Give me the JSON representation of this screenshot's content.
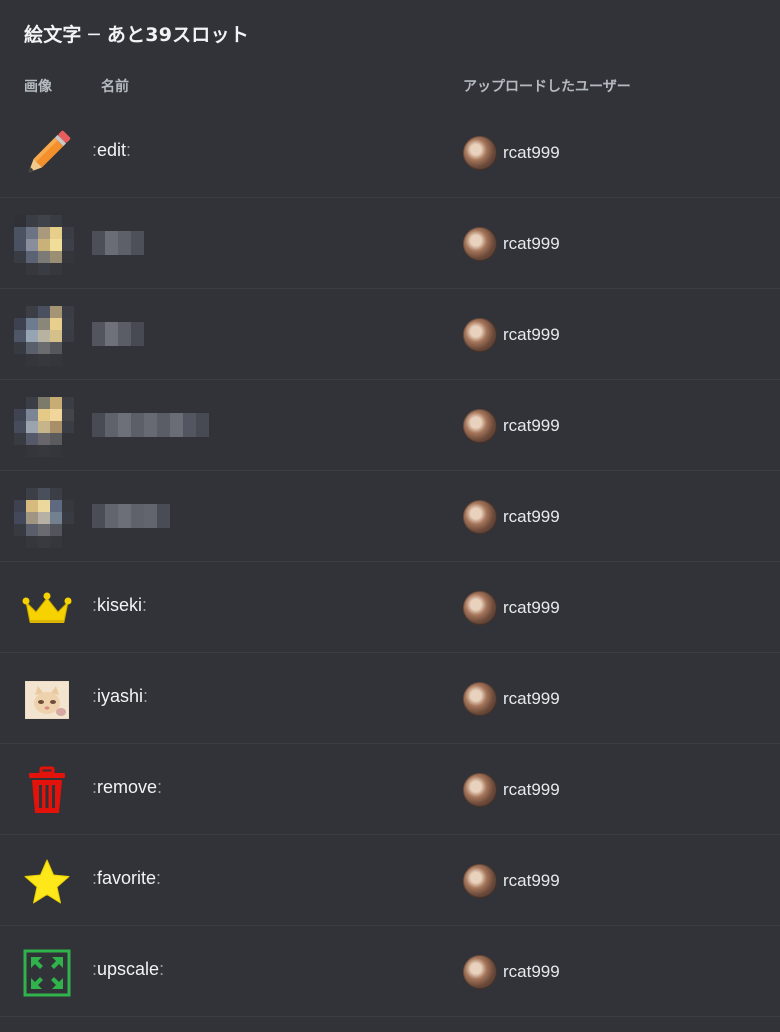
{
  "header": {
    "title": "絵文字 ─ あと39スロット",
    "col_image": "画像",
    "col_name": "名前",
    "col_uploader": "アップロードしたユーザー"
  },
  "emojis": [
    {
      "name": "edit",
      "icon": "pencil-icon",
      "uploader": "rcat999",
      "blurred": false
    },
    {
      "name": "",
      "icon": "blurred-image",
      "uploader": "rcat999",
      "blurred": true
    },
    {
      "name": "",
      "icon": "blurred-image",
      "uploader": "rcat999",
      "blurred": true
    },
    {
      "name": "",
      "icon": "blurred-image",
      "uploader": "rcat999",
      "blurred": true
    },
    {
      "name": "",
      "icon": "blurred-image",
      "uploader": "rcat999",
      "blurred": true
    },
    {
      "name": "kiseki",
      "icon": "crown-icon",
      "uploader": "rcat999",
      "blurred": false
    },
    {
      "name": "iyashi",
      "icon": "cat-photo-icon",
      "uploader": "rcat999",
      "blurred": false
    },
    {
      "name": "remove",
      "icon": "trash-icon",
      "uploader": "rcat999",
      "blurred": false
    },
    {
      "name": "favorite",
      "icon": "star-icon",
      "uploader": "rcat999",
      "blurred": false
    },
    {
      "name": "upscale",
      "icon": "expand-arrows-icon",
      "uploader": "rcat999",
      "blurred": false
    }
  ],
  "colors": {
    "background": "#313338",
    "pencil": "#f4902c",
    "crown": "#f5d200",
    "trash": "#e3120b",
    "star": "#ffe81a",
    "upscale": "#2fb34a"
  }
}
